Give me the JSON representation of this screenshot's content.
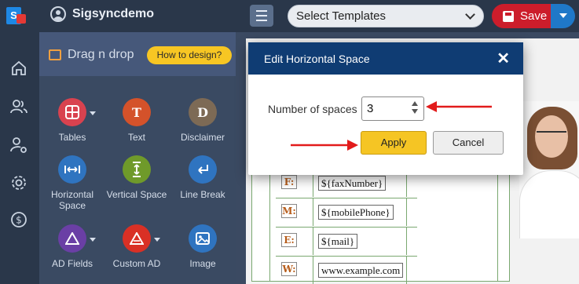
{
  "header": {
    "org_name": "Sigsyncdemo",
    "template_select": "Select Templates",
    "save_label": "Save"
  },
  "rail": {
    "icons": [
      "home-icon",
      "users-icon",
      "user-settings-icon",
      "gear-icon",
      "dollar-icon"
    ]
  },
  "panel": {
    "title": "Drag n drop",
    "help_button": "How to design?",
    "tools": [
      {
        "label": "Tables",
        "glyph": "",
        "color": "#d9424f"
      },
      {
        "label": "Text",
        "glyph": "T",
        "color": "#d4522a"
      },
      {
        "label": "Disclaimer",
        "glyph": "D",
        "color": "#7d6a55"
      },
      {
        "label": "Horizontal Space",
        "glyph": "",
        "color": "#2f74c0"
      },
      {
        "label": "Vertical Space",
        "glyph": "",
        "color": "#6f9a2a"
      },
      {
        "label": "Line Break",
        "glyph": "",
        "color": "#2f74c0"
      },
      {
        "label": "AD Fields",
        "glyph": "",
        "color": "#6a3fa5"
      },
      {
        "label": "Custom AD",
        "glyph": "",
        "color": "#d93025"
      },
      {
        "label": "Image",
        "glyph": "",
        "color": "#2f74c0"
      }
    ]
  },
  "signature": {
    "rows": [
      {
        "label": "F:",
        "value": "${faxNumber}"
      },
      {
        "label": "M:",
        "value": "${mobilePhone}"
      },
      {
        "label": "E:",
        "value": "${mail}"
      },
      {
        "label": "W:",
        "value": "www.example.com"
      }
    ]
  },
  "modal": {
    "title": "Edit Horizontal Space",
    "close": "✕",
    "field_label": "Number of spaces",
    "field_value": "3",
    "apply_label": "Apply",
    "cancel_label": "Cancel"
  }
}
